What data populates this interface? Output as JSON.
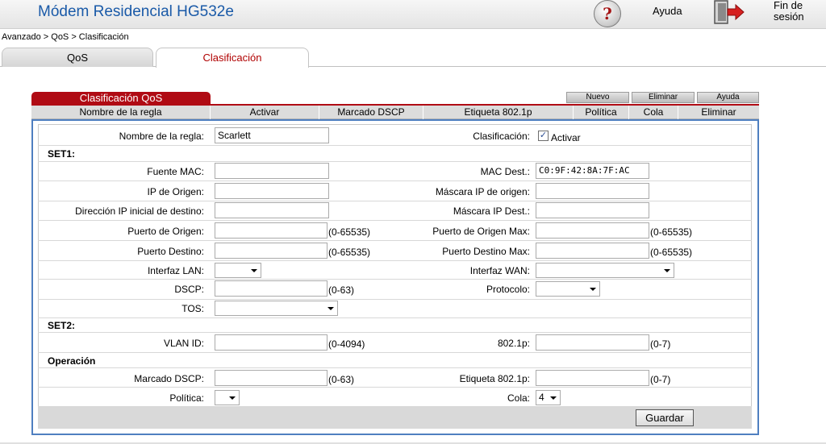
{
  "header": {
    "title": "Módem Residencial HG532e",
    "help_label": "Ayuda",
    "logout_label": "Fin de sesión",
    "help_icon_glyph": "?"
  },
  "breadcrumb": "Avanzado > QoS > Clasificación",
  "tabs": [
    {
      "label": "QoS",
      "active": false
    },
    {
      "label": "Clasificación",
      "active": true
    }
  ],
  "panel": {
    "title": "Clasificación QoS",
    "buttons": [
      "Nuevo",
      "Eliminar",
      "Ayuda"
    ],
    "columns": [
      "Nombre de la regla",
      "Activar",
      "Marcado DSCP",
      "Etiqueta 802.1p",
      "Política",
      "Cola",
      "Eliminar"
    ]
  },
  "form": {
    "rule_name_label": "Nombre de la regla:",
    "rule_name_value": "Scarlett",
    "classification_label": "Clasificación:",
    "activate_label": "Activar",
    "activate_checked": true,
    "set1_title": "SET1:",
    "src_mac_label": "Fuente MAC:",
    "src_mac_value": "",
    "dst_mac_label": "MAC Dest.:",
    "dst_mac_value": "C0:9F:42:8A:7F:AC",
    "src_ip_label": "IP de Origen:",
    "src_mask_label": "Máscara IP de origen:",
    "dst_ip_start_label": "Dirección IP inicial de destino:",
    "dst_mask_label": "Máscara IP Dest.:",
    "src_port_label": "Puerto de Origen:",
    "src_port_range": "(0-65535)",
    "src_port_max_label": "Puerto de Origen Max:",
    "src_port_max_range": "(0-65535)",
    "dst_port_label": "Puerto Destino:",
    "dst_port_range": "(0-65535)",
    "dst_port_max_label": "Puerto Destino Max:",
    "dst_port_max_range": "(0-65535)",
    "lan_if_label": "Interfaz LAN:",
    "lan_if_value": "",
    "wan_if_label": "Interfaz WAN:",
    "wan_if_value": "",
    "dscp_label": "DSCP:",
    "dscp_range": "(0-63)",
    "protocol_label": "Protocolo:",
    "protocol_value": "",
    "tos_label": "TOS:",
    "tos_value": "",
    "set2_title": "SET2:",
    "vlan_label": "VLAN ID:",
    "vlan_range": "(0-4094)",
    "p8021_label": "802.1p:",
    "p8021_range": "(0-7)",
    "op_title": "Operación",
    "mark_dscp_label": "Marcado DSCP:",
    "mark_dscp_range": "(0-63)",
    "tag_8021p_label": "Etiqueta 802.1p:",
    "tag_8021p_range": "(0-7)",
    "policy_label": "Política:",
    "policy_value": "",
    "queue_label": "Cola:",
    "queue_value": "4",
    "save_label": "Guardar"
  },
  "colors": {
    "brand_red": "#b00b14",
    "title_blue": "#1a5aa8",
    "frame_blue": "#4f7fc0"
  }
}
